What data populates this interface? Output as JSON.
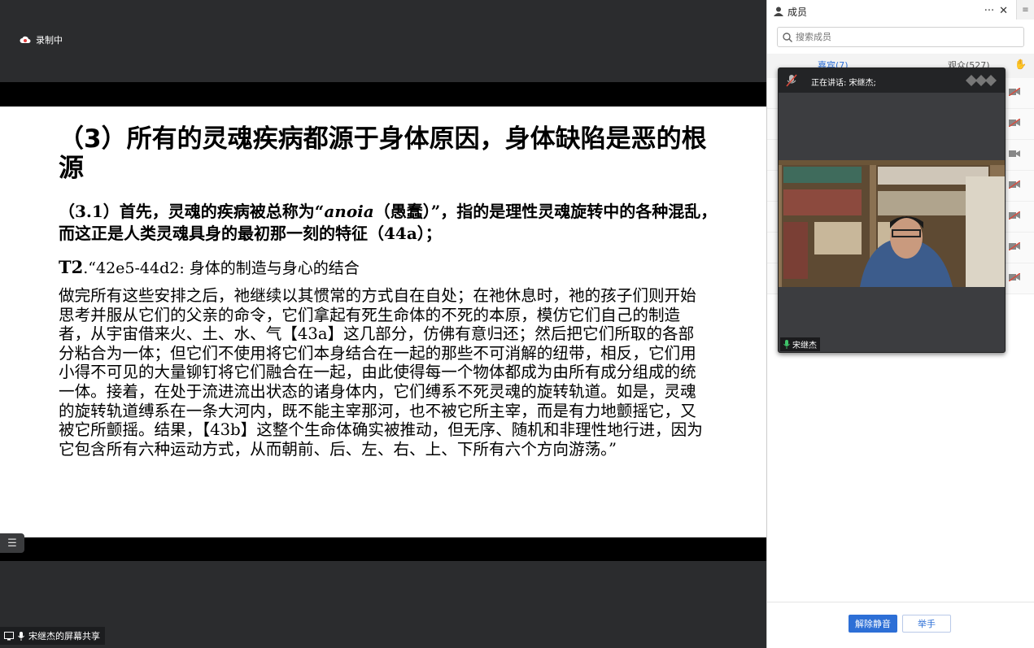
{
  "recording": {
    "label": "录制中"
  },
  "slide": {
    "title": "（3）所有的灵魂疾病都源于身体原因，身体缺陷是恶的根源",
    "p31_prefix": "（3.1）首先，灵魂的疾病被总称为“",
    "p31_term": "anoia",
    "p31_suffix": "（愚蠢）”，指的是理性灵魂旋转中的各种混乱，而这正是人类灵魂具身的最初那一刻的特征（44a）；",
    "t2_label": "T2",
    "t2_text": ".“42e5-44d2: 身体的制造与身心的结合",
    "body": "做完所有这些安排之后，祂继续以其惯常的方式自在自处；在祂休息时，祂的孩子们则开始思考并服从它们的父亲的命令，它们拿起有死生命体的不死的本原，模仿它们自己的制造者，从宇宙借来火、土、水、气【43a】这几部分，仿佛有意归还；然后把它们所取的各部分粘合为一体；但它们不使用将它们本身结合在一起的那些不可消解的纽带，相反，它们用小得不可见的大量铆钉将它们融合在一起，由此使得每一个物体都成为由所有成分组成的统一体。接着，在处于流进流出状态的诸身体内，它们缚系不死灵魂的旋转轨道。如是，灵魂的旋转轨道缚系在一条大河内，既不能主宰那河，也不被它所主宰，而是有力地颤摇它，又被它所颤摇。结果，【43b】这整个生命体确实被推动，但无序、随机和非理性地行进，因为它包含所有六种运动方式，从而朝前、后、左、右、上、下所有六个方向游荡。”"
  },
  "share_label": "宋继杰的屏幕共享",
  "panel": {
    "title": "成员",
    "more": "···",
    "close": "✕",
    "search_placeholder": "搜索成员",
    "tabs": [
      {
        "label": "嘉宾(7)"
      },
      {
        "label": "观众(527)"
      }
    ],
    "buttons": {
      "unmute": "解除静音",
      "raise_hand": "举手"
    }
  },
  "video": {
    "speaking": "正在讲话: 宋继杰;",
    "speaker_name": "宋继杰"
  },
  "colors": {
    "accent": "#2d6fd6",
    "muted": "#d94a3c"
  }
}
